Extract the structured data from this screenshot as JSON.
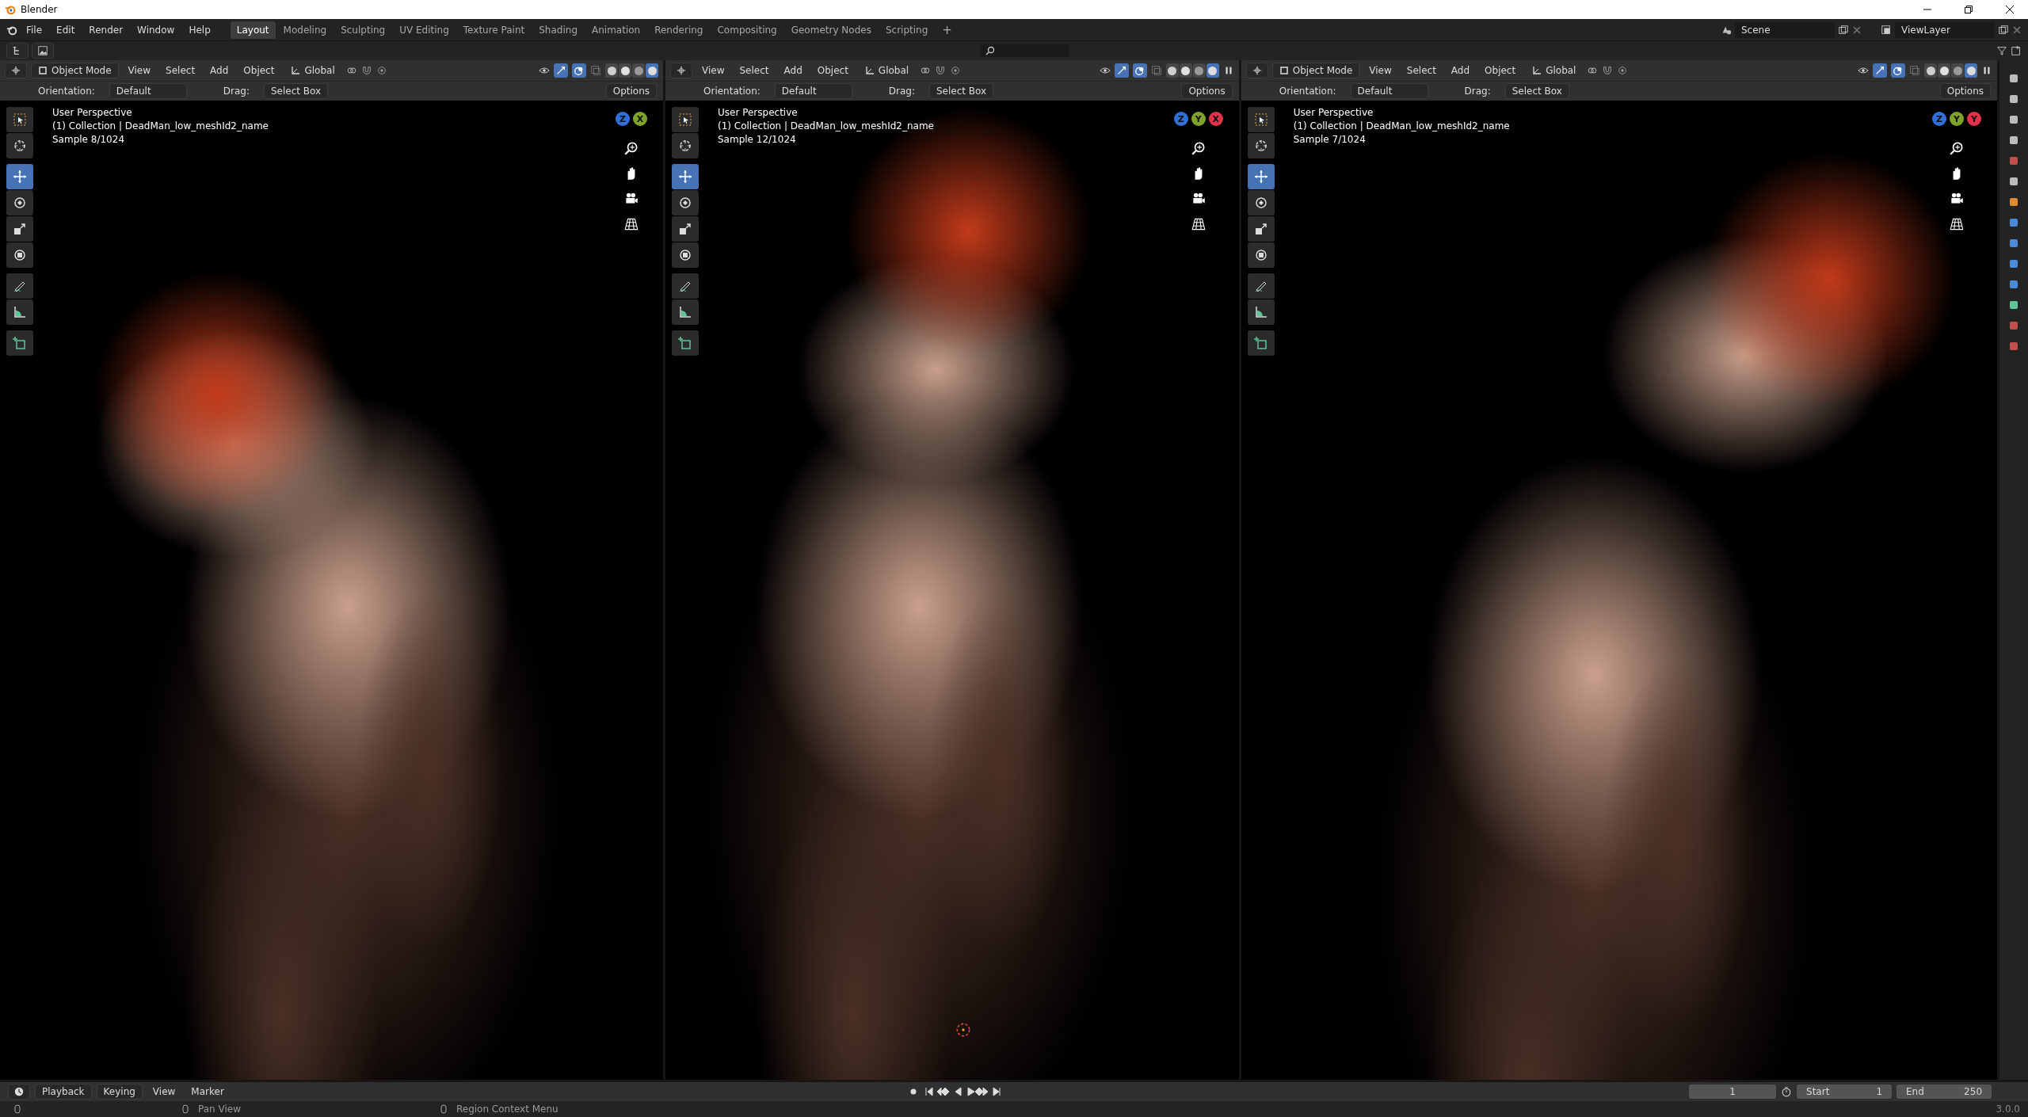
{
  "window": {
    "title": "Blender"
  },
  "menu": [
    "File",
    "Edit",
    "Render",
    "Window",
    "Help"
  ],
  "workspaces": [
    {
      "label": "Layout",
      "selected": true
    },
    {
      "label": "Modeling",
      "selected": false
    },
    {
      "label": "Sculpting",
      "selected": false
    },
    {
      "label": "UV Editing",
      "selected": false
    },
    {
      "label": "Texture Paint",
      "selected": false
    },
    {
      "label": "Shading",
      "selected": false
    },
    {
      "label": "Animation",
      "selected": false
    },
    {
      "label": "Rendering",
      "selected": false
    },
    {
      "label": "Compositing",
      "selected": false
    },
    {
      "label": "Geometry Nodes",
      "selected": false
    },
    {
      "label": "Scripting",
      "selected": false
    }
  ],
  "add_workspace": "+",
  "scene": "Scene",
  "view_layer": "ViewLayer",
  "viewports": [
    {
      "mode": "Object Mode",
      "menus": [
        "View",
        "Select",
        "Add",
        "Object"
      ],
      "orientation": "Global",
      "orientation_label": "Orientation:",
      "orientation_value": "Default",
      "drag_label": "Drag:",
      "drag_value": "Select Box",
      "options": "Options",
      "overlay": [
        "User Perspective",
        "(1) Collection | DeadMan_low_meshId2_name",
        "Sample 8/1024"
      ],
      "gizmo": [
        "Z",
        "X"
      ],
      "shading": [
        {
          "kind": "wireframe",
          "selected": false
        },
        {
          "kind": "solid",
          "selected": false
        },
        {
          "kind": "material",
          "selected": false
        },
        {
          "kind": "rendered",
          "selected": true
        }
      ],
      "tools": [
        {
          "kind": "select",
          "selected": false
        },
        {
          "kind": "cursor",
          "selected": false
        },
        {
          "kind": "move",
          "selected": true
        },
        {
          "kind": "rotate",
          "selected": false
        },
        {
          "kind": "scale",
          "selected": false
        },
        {
          "kind": "transform",
          "selected": false
        },
        {
          "kind": "annotate",
          "selected": false
        },
        {
          "kind": "measure",
          "selected": false
        },
        {
          "kind": "add",
          "selected": false
        }
      ]
    },
    {
      "menus": [
        "View",
        "Select",
        "Add",
        "Object"
      ],
      "orientation": "Global",
      "orientation_label": "Orientation:",
      "orientation_value": "Default",
      "drag_label": "Drag:",
      "drag_value": "Select Box",
      "options": "Options",
      "overlay": [
        "User Perspective",
        "(1) Collection | DeadMan_low_meshId2_name",
        "Sample 12/1024"
      ],
      "gizmo": [
        "Z",
        "Y",
        "X"
      ],
      "shading": [
        {
          "kind": "wireframe",
          "selected": false
        },
        {
          "kind": "solid",
          "selected": false
        },
        {
          "kind": "material",
          "selected": false
        },
        {
          "kind": "rendered",
          "selected": true
        }
      ],
      "tools": [
        {
          "kind": "select",
          "selected": false
        },
        {
          "kind": "cursor",
          "selected": false
        },
        {
          "kind": "move",
          "selected": true
        },
        {
          "kind": "rotate",
          "selected": false
        },
        {
          "kind": "scale",
          "selected": false
        },
        {
          "kind": "transform",
          "selected": false
        },
        {
          "kind": "annotate",
          "selected": false
        },
        {
          "kind": "measure",
          "selected": false
        },
        {
          "kind": "add",
          "selected": false
        }
      ]
    },
    {
      "mode": "Object Mode",
      "menus": [
        "View",
        "Select",
        "Add",
        "Object"
      ],
      "orientation": "Global",
      "orientation_label": "Orientation:",
      "orientation_value": "Default",
      "drag_label": "Drag:",
      "drag_value": "Select Box",
      "options": "Options",
      "overlay": [
        "User Perspective",
        "(1) Collection | DeadMan_low_meshId2_name",
        "Sample 7/1024"
      ],
      "gizmo": [
        "Z",
        "Y",
        "Y"
      ],
      "shading": [
        {
          "kind": "wireframe",
          "selected": false
        },
        {
          "kind": "solid",
          "selected": false
        },
        {
          "kind": "material",
          "selected": false
        },
        {
          "kind": "rendered",
          "selected": true
        }
      ],
      "tools": [
        {
          "kind": "select",
          "selected": false
        },
        {
          "kind": "cursor",
          "selected": false
        },
        {
          "kind": "move",
          "selected": true
        },
        {
          "kind": "rotate",
          "selected": false
        },
        {
          "kind": "scale",
          "selected": false
        },
        {
          "kind": "transform",
          "selected": false
        },
        {
          "kind": "annotate",
          "selected": false
        },
        {
          "kind": "measure",
          "selected": false
        },
        {
          "kind": "add",
          "selected": false
        }
      ]
    }
  ],
  "timeline": {
    "menus": [
      "Playback",
      "Keying",
      "View",
      "Marker"
    ],
    "current_frame": "1",
    "start_label": "Start",
    "start": "1",
    "end_label": "End",
    "end": "250"
  },
  "status_bar": {
    "hints": [
      "Pan View",
      "Region Context Menu"
    ],
    "version": "3.0.0"
  }
}
